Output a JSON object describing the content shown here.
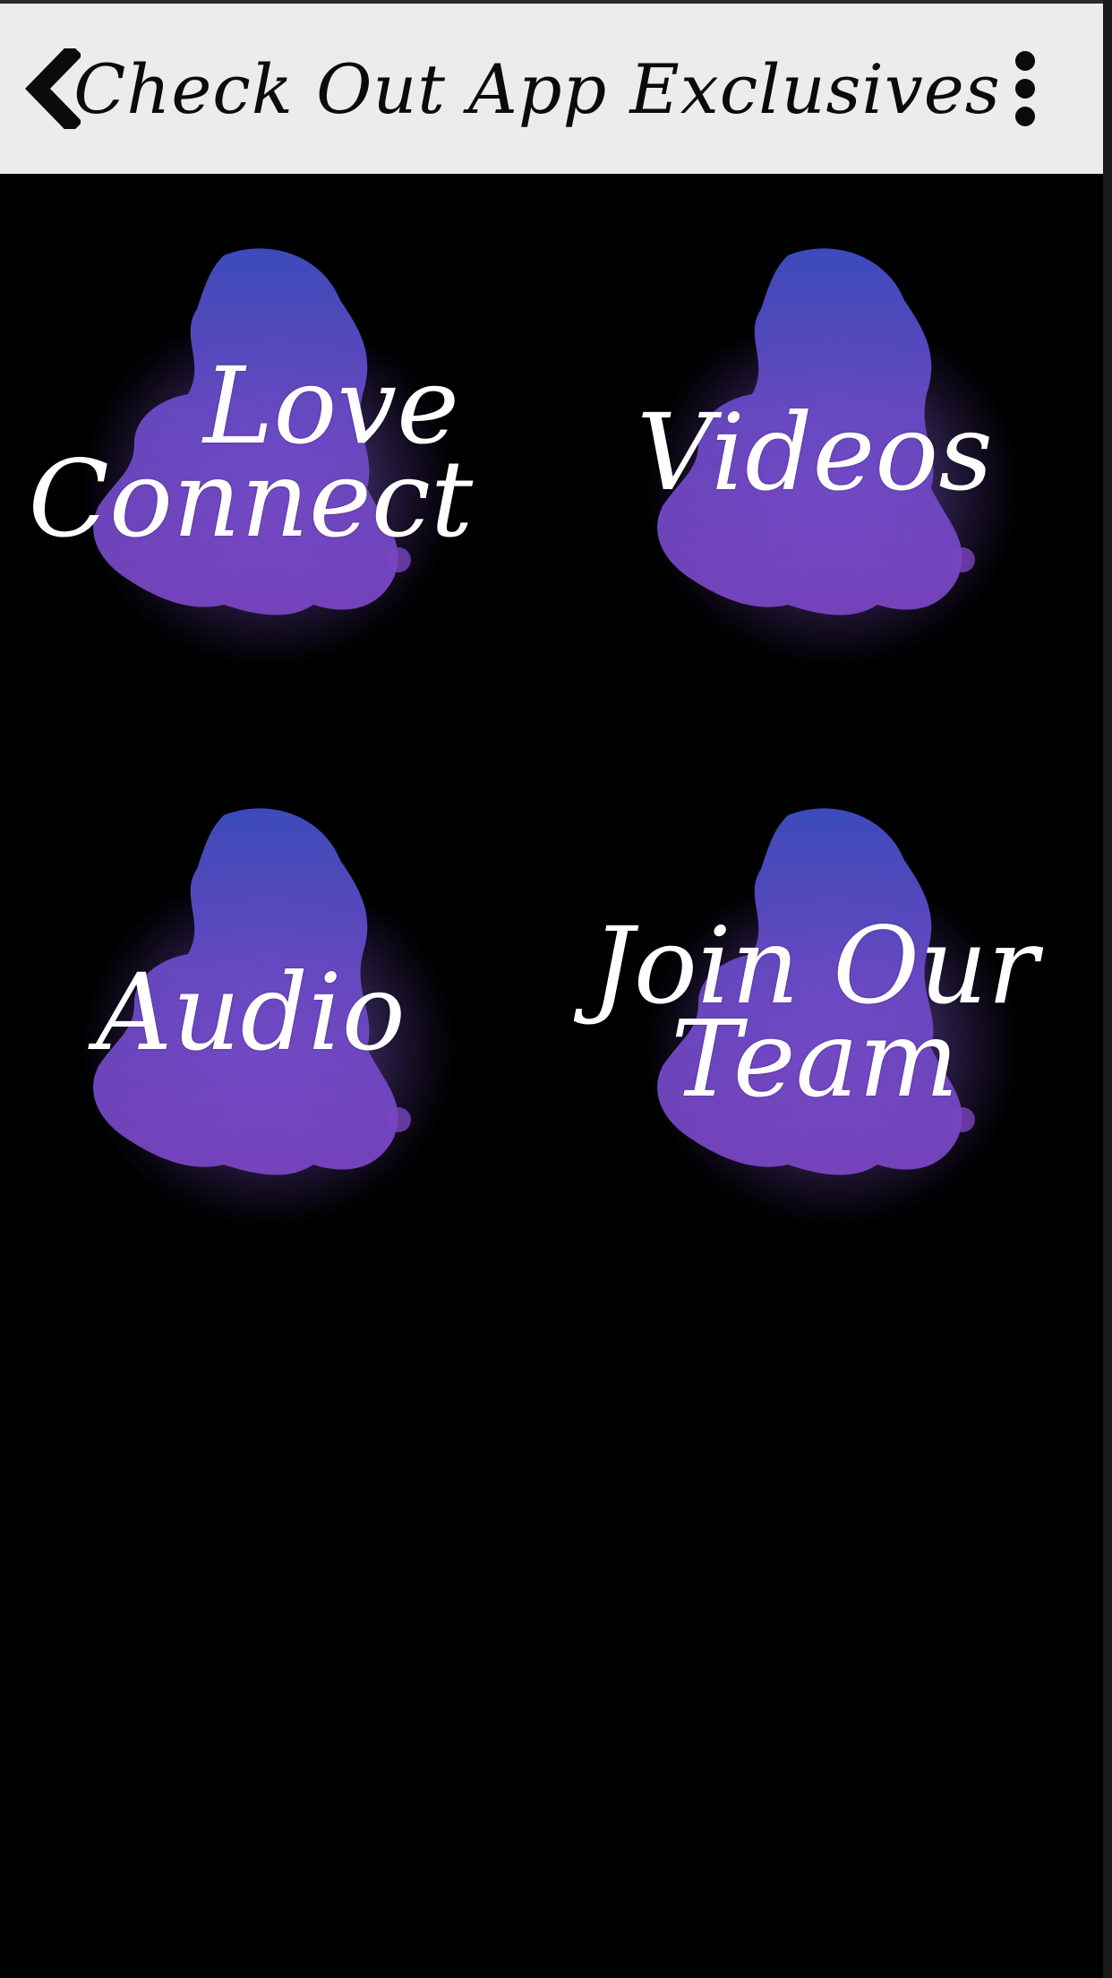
{
  "header": {
    "title": "Check Out App Exclusives",
    "back_icon": "chevron-left-icon",
    "menu_icon": "more-vertical-icon"
  },
  "tiles": [
    {
      "line1": "Love",
      "line2": "Connect"
    },
    {
      "line1": "Videos",
      "line2": ""
    },
    {
      "line1": "Audio",
      "line2": ""
    },
    {
      "line1": "Join Our",
      "line2": "Team"
    }
  ],
  "colors": {
    "background": "#000000",
    "header_bg": "#ececec",
    "header_text": "#0b0b0b",
    "cloud_blue": "#3f4fc4",
    "cloud_purple": "#7a45c2"
  }
}
